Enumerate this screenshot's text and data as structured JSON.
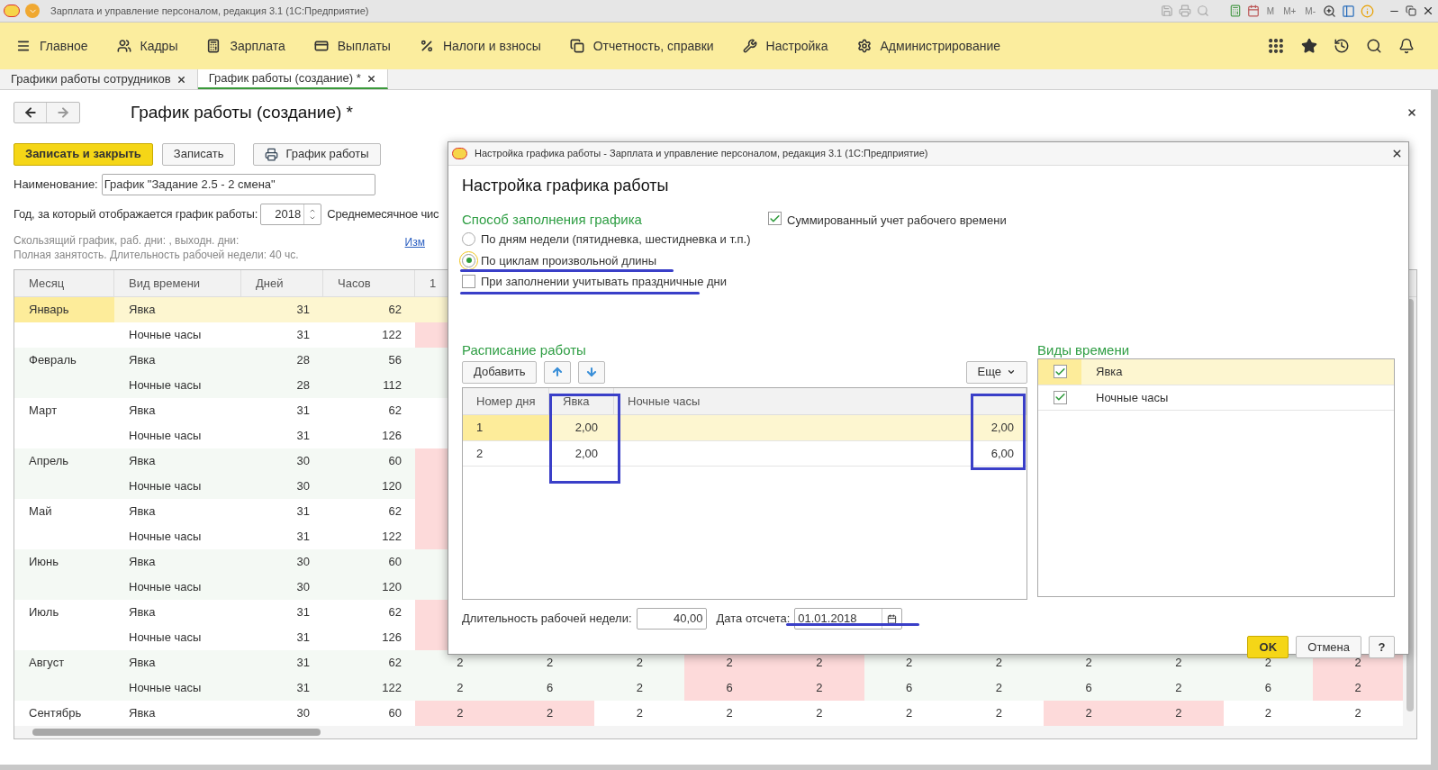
{
  "app_title": "Зарплата и управление персоналом, редакция 3.1  (1С:Предприятие)",
  "memory_buttons": [
    "M",
    "M+",
    "M-"
  ],
  "sections_menu": [
    "Главное",
    "Кадры",
    "Зарплата",
    "Выплаты",
    "Налоги и взносы",
    "Отчетность, справки",
    "Настройка",
    "Администрирование"
  ],
  "tabs": [
    {
      "label": "Графики работы сотрудников",
      "selected": false
    },
    {
      "label": "График работы (создание) *",
      "selected": true
    }
  ],
  "form": {
    "title": "График работы (создание) *",
    "buttons": [
      {
        "label": "Записать и закрыть",
        "kind": "primary"
      },
      {
        "label": "Записать",
        "kind": "plain"
      },
      {
        "label": "График работы",
        "kind": "print"
      }
    ],
    "name_label": "Наименование:",
    "name_value": "График \"Задание 2.5 - 2 смена\"",
    "year_label": "Год, за который отображается график работы:",
    "year_value": "2018",
    "avg_label": "Среднемесячное чис",
    "info_lines": [
      "Скользящий график, раб. дни: , выходн. дни:",
      "Полная занятость. Длительность рабочей недели: 40 чс."
    ],
    "link": "Изм"
  },
  "table": {
    "columns": [
      "Месяц",
      "Вид времени",
      "Дней",
      "Часов",
      "1"
    ],
    "rows": [
      {
        "month": "Январь",
        "time_kind": "Явка",
        "days": "31",
        "hours": "62",
        "selected": true,
        "cells": [
          {
            "holiday": false
          }
        ]
      },
      {
        "time_kind": "Ночные часы",
        "days": "31",
        "hours": "122",
        "selected": false,
        "cells": [
          {
            "holiday": true
          }
        ]
      },
      {
        "month": "Февраль",
        "time_kind": "Явка",
        "days": "28",
        "hours": "56",
        "selected": false,
        "cells": [
          {
            "holiday": false
          }
        ]
      },
      {
        "time_kind": "Ночные часы",
        "days": "28",
        "hours": "112",
        "selected": false,
        "cells": [
          {
            "holiday": false
          }
        ]
      },
      {
        "month": "Март",
        "time_kind": "Явка",
        "days": "31",
        "hours": "62",
        "selected": false,
        "cells": [
          {
            "holiday": false
          }
        ]
      },
      {
        "time_kind": "Ночные часы",
        "days": "31",
        "hours": "126",
        "selected": false,
        "cells": [
          {
            "holiday": false
          }
        ]
      },
      {
        "month": "Апрель",
        "time_kind": "Явка",
        "days": "30",
        "hours": "60",
        "selected": false,
        "cells": [
          {
            "holiday": true
          }
        ]
      },
      {
        "time_kind": "Ночные часы",
        "days": "30",
        "hours": "120",
        "selected": false,
        "cells": [
          {
            "holiday": true
          }
        ]
      },
      {
        "month": "Май",
        "time_kind": "Явка",
        "days": "31",
        "hours": "62",
        "selected": false,
        "cells": [
          {
            "holiday": true
          }
        ]
      },
      {
        "time_kind": "Ночные часы",
        "days": "31",
        "hours": "122",
        "selected": false,
        "cells": [
          {
            "holiday": true
          }
        ]
      },
      {
        "month": "Июнь",
        "time_kind": "Явка",
        "days": "30",
        "hours": "60",
        "selected": false,
        "cells": [
          {
            "holiday": false
          }
        ]
      },
      {
        "time_kind": "Ночные часы",
        "days": "30",
        "hours": "120",
        "selected": false,
        "cells": [
          {
            "holiday": false
          }
        ]
      },
      {
        "month": "Июль",
        "time_kind": "Явка",
        "days": "31",
        "hours": "62",
        "selected": false,
        "cells": [
          {
            "holiday": true
          }
        ]
      },
      {
        "time_kind": "Ночные часы",
        "days": "31",
        "hours": "126",
        "selected": false,
        "cells": [
          {
            "holiday": true
          }
        ]
      },
      {
        "month": "Август",
        "time_kind": "Явка",
        "days": "31",
        "hours": "62",
        "selected": false,
        "cells": [
          {
            "value": "2",
            "holiday": false
          },
          {
            "value": "2",
            "holiday": false
          },
          {
            "value": "2",
            "holiday": false
          },
          {
            "value": "2",
            "holiday": true
          },
          {
            "value": "2",
            "holiday": true
          },
          {
            "value": "2",
            "holiday": false
          },
          {
            "value": "2",
            "holiday": false
          },
          {
            "value": "2",
            "holiday": false
          },
          {
            "value": "2",
            "holiday": false
          },
          {
            "value": "2",
            "holiday": false
          },
          {
            "value": "2",
            "holiday": true
          }
        ]
      },
      {
        "time_kind": "Ночные часы",
        "days": "31",
        "hours": "122",
        "selected": false,
        "cells": [
          {
            "value": "2",
            "holiday": false
          },
          {
            "value": "6",
            "holiday": false
          },
          {
            "value": "2",
            "holiday": false
          },
          {
            "value": "6",
            "holiday": true
          },
          {
            "value": "2",
            "holiday": true
          },
          {
            "value": "6",
            "holiday": false
          },
          {
            "value": "2",
            "holiday": false
          },
          {
            "value": "6",
            "holiday": false
          },
          {
            "value": "2",
            "holiday": false
          },
          {
            "value": "6",
            "holiday": false
          },
          {
            "value": "2",
            "holiday": true
          }
        ]
      },
      {
        "month": "Сентябрь",
        "time_kind": "Явка",
        "days": "30",
        "hours": "60",
        "selected": false,
        "cells": [
          {
            "value": "2",
            "holiday": true
          },
          {
            "value": "2",
            "holiday": true
          },
          {
            "value": "2",
            "holiday": false
          },
          {
            "value": "2",
            "holiday": false
          },
          {
            "value": "2",
            "holiday": false
          },
          {
            "value": "2",
            "holiday": false
          },
          {
            "value": "2",
            "holiday": false
          },
          {
            "value": "2",
            "holiday": true
          },
          {
            "value": "2",
            "holiday": true
          },
          {
            "value": "2",
            "holiday": false
          },
          {
            "value": "2",
            "holiday": false
          }
        ]
      }
    ]
  },
  "dialog": {
    "window_title": "Настройка графика работы - Зарплата и управление персоналом, редакция 3.1  (1С:Предприятие)",
    "heading": "Настройка графика работы",
    "fill_method": {
      "caption": "Способ заполнения графика",
      "options": [
        {
          "label": "По дням недели (пятидневка, шестидневка и т.п.)",
          "selected": false
        },
        {
          "label": "По циклам произвольной длины",
          "selected": true
        }
      ]
    },
    "holidays_checkbox": {
      "label": "При заполнении учитывать праздничные дни",
      "checked": false
    },
    "summarized_checkbox": {
      "label": "Суммированный учет рабочего времени",
      "checked": true
    },
    "schedule": {
      "caption": "Расписание работы",
      "add_button": "Добавить",
      "more_button": "Еще",
      "columns": [
        "Номер дня",
        "Явка",
        "Ночные часы"
      ],
      "rows": [
        {
          "day": "1",
          "attendance": "2,00",
          "night": "2,00",
          "selected": true
        },
        {
          "day": "2",
          "attendance": "2,00",
          "night": "6,00",
          "selected": false
        }
      ]
    },
    "time_kinds": {
      "caption": "Виды времени",
      "items": [
        {
          "label": "Явка",
          "checked": true,
          "selected": true
        },
        {
          "label": "Ночные часы",
          "checked": true,
          "selected": false
        }
      ]
    },
    "week_label": "Длительность рабочей недели:",
    "week_value": "40,00",
    "date_label": "Дата отсчета:",
    "date_value": "01.01.2018",
    "ok": "OK",
    "cancel": "Отмена",
    "help": "?"
  }
}
